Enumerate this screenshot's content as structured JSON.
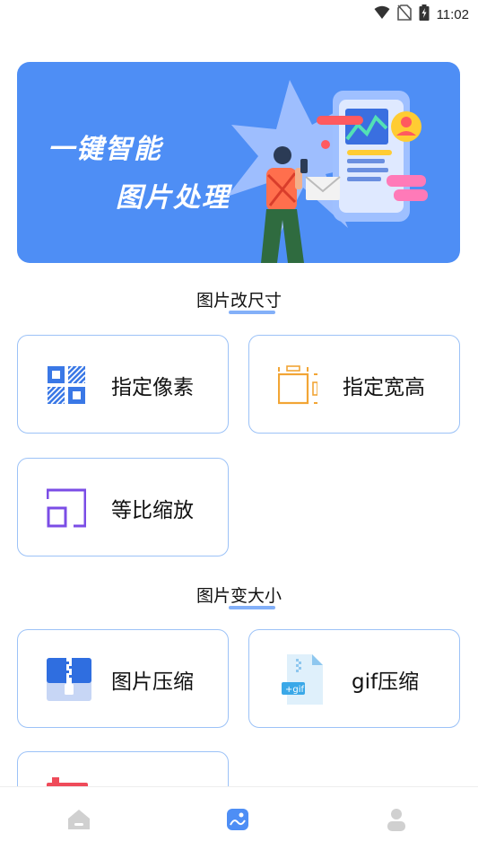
{
  "status_bar": {
    "time": "11:02",
    "icons": [
      "wifi-icon",
      "no-sim-icon",
      "battery-charging-icon"
    ]
  },
  "banner": {
    "line1": "一键智能",
    "line2": "图片处理",
    "color": "#4e8ef5"
  },
  "sections": [
    {
      "title": "图片改尺寸",
      "items": [
        {
          "label": "指定像素",
          "icon": "grid-pixel-icon"
        },
        {
          "label": "指定宽高",
          "icon": "width-height-icon"
        },
        {
          "label": "等比缩放",
          "icon": "proportional-scale-icon"
        }
      ]
    },
    {
      "title": "图片变大小",
      "items": [
        {
          "label": "图片压缩",
          "icon": "zip-compress-icon"
        },
        {
          "label": "gif压缩",
          "icon": "gif-file-icon"
        }
      ]
    }
  ],
  "bottom_nav": {
    "items": [
      {
        "name": "home-icon",
        "active": false
      },
      {
        "name": "image-tools-icon",
        "active": true
      },
      {
        "name": "profile-icon",
        "active": false
      }
    ],
    "active_color": "#4e8ef5",
    "inactive_color": "#d0d0d0"
  }
}
